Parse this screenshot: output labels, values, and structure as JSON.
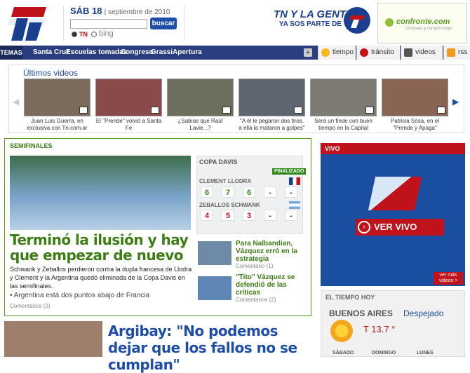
{
  "header": {
    "date_day": "SÁB 18",
    "date_rest": "| septiembre de 2010",
    "search_button": "buscar",
    "search_placeholder": "",
    "radio_tn": "TN",
    "bing": "bing",
    "tngente_title": "TN Y LA GENTE",
    "tngente_sub": "YA SOS PARTE DE TN",
    "ad_text": "confronte.com",
    "ad_sub": "compará y comprá mejor"
  },
  "nav": {
    "temas": "TEMAS",
    "links": [
      "Santa Cruz",
      "Escuelas tomadas",
      "Congreso",
      "Grassi",
      "Apertura"
    ],
    "plus": "+",
    "tools": [
      "tiempo",
      "tránsito",
      "videos",
      "rss"
    ]
  },
  "videos": {
    "title": "Últimos videos",
    "items": [
      "Juan Luis Guerra, en exclusiva con Tn.com.ar",
      "El \"Prende\" volvió a Santa Fe",
      "¿Sabías que Raúl Lavie...?",
      "\"A él le pegaron dos tiros, a ella la mataron a golpes\"",
      "Será un finde con buen tiempo en la Capital",
      "Patricia Sosa, en el \"Prende y Apaga\""
    ]
  },
  "main": {
    "label": "SEMIFINALES",
    "headline": "Terminó la ilusión y hay que empezar de nuevo",
    "summary": "Schwank y Zeballos perdieron contra la dupla francesa de Llodra y Clement y la Argentina quedó eliminada de la Copa Davis en las semifinales.",
    "bullet": "• Argentina está dos puntos abajo de Francia",
    "comments": "Comentarios (2)"
  },
  "davis": {
    "title": "COPA DAVIS",
    "status": "FINALIZADO",
    "player1": "CLEMENT LLODRA",
    "scores1": [
      "6",
      "7",
      "6",
      "-",
      "-"
    ],
    "player2": "ZEBALLOS SCHWANK",
    "scores2": [
      "4",
      "5",
      "3",
      "-",
      "-"
    ]
  },
  "side": [
    {
      "title": "Para Nalbandian, Vázquez erró en la estrategia",
      "comments": "Comentario (1)"
    },
    {
      "title": "\"Tito\" Vázquez se defendió de las críticas",
      "comments": "Comentarios (2)"
    }
  ],
  "second": {
    "headline": "Argibay: \"No podemos dejar que los fallos no se cumplan\""
  },
  "vivo": {
    "label": "VIVO",
    "button": "VER VIVO",
    "more": "ver más videos >"
  },
  "tiempo": {
    "title": "EL TIEMPO HOY",
    "city": "BUENOS AIRES",
    "state": "Despejado",
    "temp": "T 13.7 °",
    "days": [
      "SÁBADO",
      "DOMINGO",
      "LUNES"
    ]
  }
}
